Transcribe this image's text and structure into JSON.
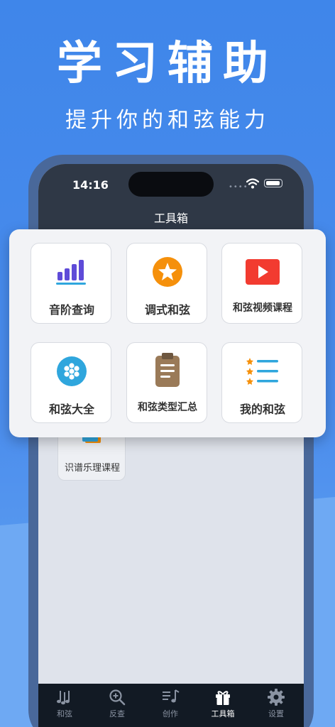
{
  "hero": {
    "title": "学习辅助",
    "subtitle": "提升你的和弦能力"
  },
  "status_bar": {
    "time": "14:16",
    "signal": "••••"
  },
  "nav": {
    "title": "工具箱"
  },
  "tools": [
    {
      "label": "音阶查询",
      "icon": "bar-chart-icon"
    },
    {
      "label": "调式和弦",
      "icon": "star-circle-icon"
    },
    {
      "label": "和弦视频课程",
      "icon": "play-video-icon"
    },
    {
      "label": "和弦大全",
      "icon": "dots-circle-icon"
    },
    {
      "label": "和弦类型汇总",
      "icon": "clipboard-icon"
    },
    {
      "label": "我的和弦",
      "icon": "star-list-icon"
    }
  ],
  "background_tile": {
    "label": "识谱乐理课程",
    "icon": "book-icon"
  },
  "tabbar": [
    {
      "label": "和弦",
      "icon": "music-notes-icon",
      "active": false
    },
    {
      "label": "反查",
      "icon": "search-plus-icon",
      "active": false
    },
    {
      "label": "创作",
      "icon": "compose-icon",
      "active": false
    },
    {
      "label": "工具箱",
      "icon": "gift-icon",
      "active": true
    },
    {
      "label": "设置",
      "icon": "gear-icon",
      "active": false
    }
  ],
  "colors": {
    "background": "#3f86ea",
    "nav": "#2f3846",
    "tabbar": "#121a24",
    "accent_orange": "#f5900b",
    "accent_red": "#f23b30",
    "accent_purple": "#5e4bd8",
    "accent_cyan": "#2fa6dd",
    "accent_brown": "#9a7a58"
  }
}
